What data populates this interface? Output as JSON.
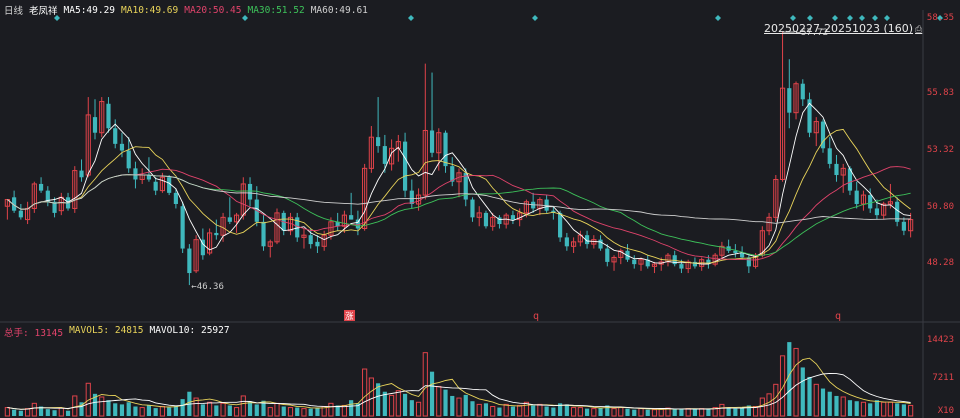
{
  "header": {
    "period": "日线",
    "stock_name": "老凤祥",
    "ma": [
      {
        "label": "MA5:",
        "value": "49.29",
        "color": "#ffffff"
      },
      {
        "label": "MA10:",
        "value": "49.69",
        "color": "#e8d35a"
      },
      {
        "label": "MA20:",
        "value": "50.45",
        "color": "#e0436b"
      },
      {
        "label": "MA30:",
        "value": "51.52",
        "color": "#3dc15a"
      },
      {
        "label": "MA60:",
        "value": "49.61",
        "color": "#cfcfcf"
      }
    ]
  },
  "range_label": "20250227-20251023 (160)",
  "lock_icon": "lock-icon",
  "price_axis": [
    "58.35",
    "55.83",
    "53.32",
    "50.80",
    "48.28"
  ],
  "annotations": {
    "high": "57.72",
    "low": "46.36",
    "badge": "涨",
    "q1": "q",
    "q2": "q"
  },
  "volume_header": {
    "title": "总手:",
    "title_value": "13145",
    "mavol5_label": "MAVOL5:",
    "mavol5_value": "24815",
    "mavol10_label": "MAVOL10:",
    "mavol10_value": "25927"
  },
  "volume_axis": {
    "top": "14423",
    "mid": "7211",
    "bottom": "X10"
  },
  "colors": {
    "up": "#e0434a",
    "down": "#3fb8bd",
    "bg": "#1b1c21",
    "ma5": "#ffffff",
    "ma10": "#e8d35a",
    "ma20": "#e0436b",
    "ma30": "#3dc15a",
    "ma60": "#cfcfcf"
  },
  "chart_data": {
    "type": "candlestick",
    "candles": [
      [
        49.9,
        50.2,
        49.3,
        50.2
      ],
      [
        50.3,
        50.6,
        49.6,
        49.7
      ],
      [
        49.7,
        50.0,
        49.3,
        49.4
      ],
      [
        49.3,
        50.1,
        49.1,
        49.8
      ],
      [
        49.8,
        51.0,
        49.6,
        50.9
      ],
      [
        50.9,
        51.2,
        50.5,
        50.6
      ],
      [
        50.6,
        50.8,
        49.9,
        50.1
      ],
      [
        50.1,
        50.3,
        49.4,
        49.6
      ],
      [
        49.7,
        50.5,
        49.5,
        50.3
      ],
      [
        50.3,
        50.5,
        49.7,
        49.8
      ],
      [
        49.8,
        51.7,
        49.6,
        51.5
      ],
      [
        51.5,
        52.0,
        51.0,
        51.2
      ],
      [
        51.3,
        54.8,
        51.2,
        54.0
      ],
      [
        53.9,
        54.7,
        52.9,
        53.2
      ],
      [
        53.2,
        54.8,
        53.0,
        54.6
      ],
      [
        54.5,
        54.8,
        53.2,
        53.4
      ],
      [
        53.4,
        53.8,
        52.5,
        52.7
      ],
      [
        52.7,
        53.2,
        52.1,
        52.4
      ],
      [
        52.4,
        53.0,
        51.4,
        51.6
      ],
      [
        51.6,
        51.9,
        50.7,
        51.1
      ],
      [
        51.1,
        51.6,
        50.9,
        51.3
      ],
      [
        51.3,
        52.1,
        51.0,
        51.1
      ],
      [
        51.0,
        51.2,
        50.4,
        50.6
      ],
      [
        50.6,
        51.4,
        50.5,
        51.2
      ],
      [
        51.2,
        51.3,
        50.4,
        50.5
      ],
      [
        50.5,
        50.7,
        49.8,
        50.0
      ],
      [
        49.9,
        50.1,
        47.8,
        48.0
      ],
      [
        48.0,
        48.2,
        46.36,
        46.9
      ],
      [
        47.0,
        48.6,
        46.9,
        48.4
      ],
      [
        48.4,
        48.9,
        47.5,
        47.7
      ],
      [
        47.8,
        48.9,
        47.7,
        48.7
      ],
      [
        48.7,
        49.3,
        48.4,
        48.6
      ],
      [
        48.6,
        49.6,
        48.3,
        49.4
      ],
      [
        49.4,
        50.3,
        49.1,
        49.2
      ],
      [
        49.2,
        49.6,
        48.7,
        49.5
      ],
      [
        49.5,
        51.2,
        49.3,
        50.9
      ],
      [
        50.9,
        51.2,
        49.9,
        50.2
      ],
      [
        50.2,
        50.8,
        49.0,
        49.2
      ],
      [
        49.2,
        49.5,
        47.9,
        48.1
      ],
      [
        48.1,
        48.4,
        47.6,
        48.3
      ],
      [
        48.3,
        49.8,
        48.2,
        49.6
      ],
      [
        49.6,
        49.7,
        48.6,
        48.8
      ],
      [
        48.8,
        49.6,
        48.6,
        49.4
      ],
      [
        49.4,
        49.6,
        48.3,
        48.5
      ],
      [
        48.5,
        48.9,
        48.0,
        48.6
      ],
      [
        48.6,
        48.9,
        48.0,
        48.2
      ],
      [
        48.3,
        48.6,
        47.8,
        48.1
      ],
      [
        48.1,
        48.8,
        47.9,
        48.6
      ],
      [
        48.6,
        49.4,
        48.4,
        49.2
      ],
      [
        49.2,
        49.6,
        48.8,
        49.0
      ],
      [
        49.0,
        49.7,
        48.7,
        49.5
      ],
      [
        49.5,
        50.5,
        49.3,
        49.3
      ],
      [
        49.3,
        49.7,
        48.6,
        48.9
      ],
      [
        48.9,
        51.8,
        48.8,
        51.6
      ],
      [
        51.6,
        53.5,
        51.4,
        53.0
      ],
      [
        53.0,
        54.8,
        52.3,
        52.6
      ],
      [
        52.6,
        53.1,
        51.4,
        51.8
      ],
      [
        51.8,
        52.9,
        51.5,
        52.5
      ],
      [
        52.5,
        53.1,
        51.9,
        52.8
      ],
      [
        52.8,
        53.2,
        50.3,
        50.6
      ],
      [
        50.6,
        51.1,
        49.8,
        50.0
      ],
      [
        50.0,
        50.7,
        49.7,
        50.4
      ],
      [
        50.4,
        56.3,
        50.2,
        53.3
      ],
      [
        53.3,
        55.9,
        52.1,
        52.3
      ],
      [
        52.3,
        53.4,
        51.5,
        53.2
      ],
      [
        53.2,
        53.3,
        51.4,
        51.7
      ],
      [
        51.7,
        52.1,
        50.8,
        51.0
      ],
      [
        51.0,
        51.6,
        50.3,
        51.4
      ],
      [
        51.4,
        51.6,
        49.9,
        50.2
      ],
      [
        50.2,
        50.3,
        49.2,
        49.4
      ],
      [
        49.4,
        49.9,
        49.0,
        49.6
      ],
      [
        49.6,
        49.7,
        48.9,
        49.0
      ],
      [
        49.0,
        49.6,
        48.8,
        49.4
      ],
      [
        49.4,
        49.5,
        48.9,
        49.1
      ],
      [
        49.1,
        49.6,
        48.9,
        49.5
      ],
      [
        49.5,
        49.7,
        49.1,
        49.3
      ],
      [
        49.3,
        49.8,
        49.0,
        49.6
      ],
      [
        49.6,
        50.2,
        49.4,
        50.1
      ],
      [
        50.1,
        50.5,
        49.6,
        49.8
      ],
      [
        49.8,
        50.3,
        49.5,
        50.2
      ],
      [
        50.2,
        50.4,
        49.6,
        49.7
      ],
      [
        49.7,
        49.9,
        49.3,
        49.6
      ],
      [
        49.6,
        49.7,
        48.3,
        48.5
      ],
      [
        48.5,
        48.7,
        47.9,
        48.1
      ],
      [
        48.1,
        48.5,
        47.8,
        48.3
      ],
      [
        48.3,
        48.8,
        48.1,
        48.6
      ],
      [
        48.6,
        48.8,
        48.0,
        48.2
      ],
      [
        48.2,
        48.6,
        48.0,
        48.4
      ],
      [
        48.4,
        48.6,
        47.9,
        48.0
      ],
      [
        48.0,
        48.2,
        47.2,
        47.4
      ],
      [
        47.4,
        47.7,
        47.0,
        47.6
      ],
      [
        47.6,
        48.0,
        47.3,
        47.9
      ],
      [
        47.9,
        48.2,
        47.4,
        47.5
      ],
      [
        47.5,
        47.7,
        47.1,
        47.3
      ],
      [
        47.3,
        47.6,
        47.0,
        47.5
      ],
      [
        47.5,
        47.7,
        47.1,
        47.2
      ],
      [
        47.2,
        47.4,
        46.9,
        47.3
      ],
      [
        47.3,
        47.6,
        47.0,
        47.4
      ],
      [
        47.4,
        47.8,
        47.2,
        47.7
      ],
      [
        47.7,
        47.9,
        47.2,
        47.3
      ],
      [
        47.3,
        47.5,
        46.9,
        47.1
      ],
      [
        47.1,
        47.5,
        46.9,
        47.4
      ],
      [
        47.4,
        47.6,
        47.1,
        47.2
      ],
      [
        47.2,
        47.6,
        47.0,
        47.5
      ],
      [
        47.5,
        47.7,
        47.1,
        47.3
      ],
      [
        47.3,
        47.8,
        47.2,
        47.7
      ],
      [
        47.7,
        48.3,
        47.5,
        48.1
      ],
      [
        48.1,
        48.4,
        47.8,
        47.9
      ],
      [
        47.9,
        48.2,
        47.6,
        47.8
      ],
      [
        47.8,
        48.1,
        47.5,
        47.6
      ],
      [
        47.6,
        47.7,
        46.9,
        47.2
      ],
      [
        47.2,
        47.8,
        47.1,
        47.7
      ],
      [
        47.7,
        49.0,
        47.6,
        48.8
      ],
      [
        48.8,
        49.6,
        48.6,
        49.4
      ],
      [
        49.4,
        51.3,
        49.2,
        51.1
      ],
      [
        51.1,
        57.72,
        51.0,
        55.2
      ],
      [
        55.2,
        56.5,
        53.4,
        54.1
      ],
      [
        54.1,
        55.5,
        53.8,
        55.4
      ],
      [
        55.4,
        55.6,
        54.4,
        54.7
      ],
      [
        54.7,
        55.0,
        53.0,
        53.2
      ],
      [
        53.2,
        53.9,
        52.6,
        53.7
      ],
      [
        53.7,
        53.8,
        52.3,
        52.5
      ],
      [
        52.5,
        53.0,
        51.6,
        51.8
      ],
      [
        51.8,
        52.2,
        51.0,
        51.3
      ],
      [
        51.3,
        51.8,
        50.5,
        51.6
      ],
      [
        51.6,
        51.7,
        50.4,
        50.6
      ],
      [
        50.6,
        51.0,
        49.8,
        50.0
      ],
      [
        50.0,
        50.6,
        49.7,
        50.4
      ],
      [
        50.4,
        50.7,
        49.6,
        49.8
      ],
      [
        49.8,
        50.2,
        49.3,
        49.5
      ],
      [
        49.5,
        50.1,
        49.3,
        50.0
      ],
      [
        50.0,
        50.9,
        49.8,
        50.1
      ],
      [
        50.1,
        50.3,
        49.0,
        49.2
      ],
      [
        49.2,
        49.4,
        48.6,
        48.8
      ],
      [
        48.8,
        49.6,
        48.5,
        49.3
      ]
    ],
    "volumes": [
      1.6,
      1.2,
      1.0,
      1.4,
      2.4,
      1.8,
      1.3,
      1.1,
      1.5,
      1.0,
      3.8,
      2.6,
      6.2,
      4.2,
      3.6,
      3.0,
      2.4,
      2.2,
      2.6,
      1.8,
      1.6,
      2.0,
      1.5,
      1.8,
      1.6,
      1.9,
      3.2,
      4.6,
      3.4,
      2.2,
      2.6,
      2.0,
      2.4,
      2.0,
      1.6,
      3.8,
      2.8,
      2.2,
      2.9,
      1.6,
      2.4,
      1.8,
      1.6,
      1.6,
      1.4,
      1.4,
      1.6,
      1.8,
      2.4,
      2.0,
      2.0,
      3.0,
      2.4,
      8.9,
      7.2,
      6.2,
      4.6,
      3.9,
      4.8,
      4.2,
      3.0,
      2.6,
      12.0,
      8.4,
      5.6,
      5.0,
      3.8,
      3.4,
      4.0,
      2.8,
      2.2,
      2.4,
      1.8,
      1.6,
      2.2,
      1.8,
      2.0,
      2.6,
      2.0,
      2.2,
      1.8,
      1.6,
      2.4,
      2.2,
      1.6,
      1.6,
      1.4,
      1.4,
      1.6,
      2.0,
      1.4,
      1.6,
      1.4,
      1.2,
      1.4,
      1.2,
      1.2,
      1.3,
      1.5,
      1.3,
      1.4,
      1.4,
      1.3,
      1.4,
      1.3,
      1.6,
      2.2,
      1.6,
      1.4,
      1.5,
      2.0,
      1.8,
      3.4,
      4.2,
      6.0,
      11.4,
      14.0,
      12.8,
      9.2,
      7.4,
      6.0,
      5.2,
      4.6,
      3.8,
      3.6,
      3.0,
      2.8,
      2.6,
      2.4,
      3.0,
      2.6,
      2.6,
      2.4,
      2.2,
      2.0
    ]
  }
}
